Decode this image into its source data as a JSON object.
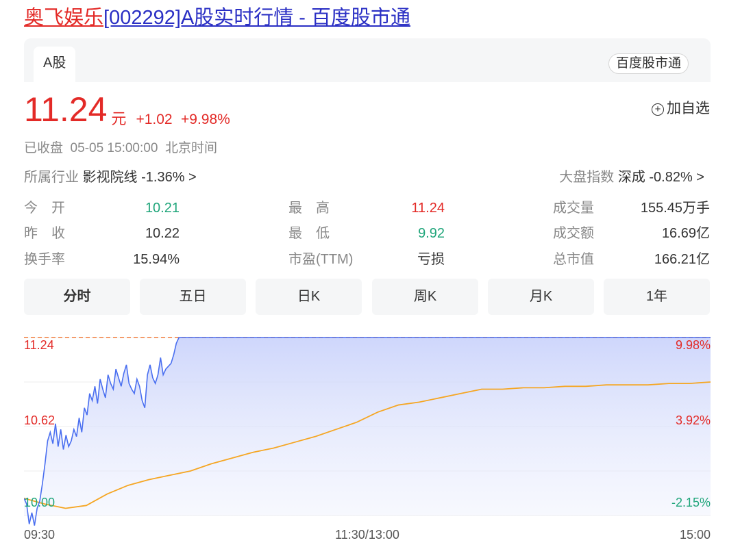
{
  "page": {
    "title_name": "奥飞娱乐",
    "title_rest": "[002292]A股实时行情 - 百度股市通"
  },
  "card": {
    "tab_label": "A股",
    "source_button": "百度股市通"
  },
  "quote": {
    "price": "11.24",
    "unit": "元",
    "change": "+1.02",
    "change_pct": "+9.98%",
    "add_watch": "加自选",
    "status": "已收盘  05-05 15:00:00  北京时间",
    "industry_label": "所属行业",
    "industry_value": "影视院线 -1.36% >",
    "index_label": "大盘指数",
    "index_value": "深成 -0.82% >"
  },
  "metrics": {
    "open_label": "今　开",
    "open_value": "10.21",
    "prev_close_label": "昨　收",
    "prev_close_value": "10.22",
    "turnover_rate_label": "换手率",
    "turnover_rate_value": "15.94%",
    "high_label": "最　高",
    "high_value": "11.24",
    "low_label": "最　低",
    "low_value": "9.92",
    "pe_label": "市盈(TTM)",
    "pe_value": "亏损",
    "volume_label": "成交量",
    "volume_value": "155.45万手",
    "amount_label": "成交额",
    "amount_value": "16.69亿",
    "market_cap_label": "总市值",
    "market_cap_value": "166.21亿"
  },
  "period_tabs": [
    "分时",
    "五日",
    "日K",
    "周K",
    "月K",
    "1年"
  ],
  "colors": {
    "up": "#e32a27",
    "down": "#1fa57a",
    "price_line": "#4a6ff0",
    "avg_line": "#f5a623",
    "limit_line": "#f07a3a"
  },
  "chart_data": {
    "type": "line",
    "y_left_ticks": [
      "11.24",
      "10.62",
      "10.00"
    ],
    "y_right_ticks": [
      "9.98%",
      "3.92%",
      "-2.15%"
    ],
    "x_ticks": [
      "09:30",
      "11:30/13:00",
      "15:00"
    ],
    "ylim": [
      10.0,
      11.24
    ],
    "series": [
      {
        "values": [
          10.12,
          10.08,
          9.94,
          10.02,
          9.93,
          10.05,
          10.1,
          10.22,
          10.36,
          10.52,
          10.58,
          10.5,
          10.64,
          10.48,
          10.6,
          10.46,
          10.56,
          10.48,
          10.52,
          10.6,
          10.55,
          10.68,
          10.58,
          10.75,
          10.7,
          10.85,
          10.8,
          10.9,
          10.78,
          10.95,
          10.88,
          10.82,
          10.98,
          10.92,
          10.88,
          11.02,
          10.96,
          10.9,
          10.99,
          11.05,
          10.92,
          10.88,
          10.85,
          10.95,
          10.9,
          10.8,
          10.75,
          10.98,
          11.05,
          10.96,
          10.92,
          10.98,
          11.1,
          10.98,
          11.02,
          11.04,
          11.06,
          11.12,
          11.2,
          11.24,
          11.24
        ]
      },
      {
        "values": [
          10.12,
          10.08,
          10.05,
          10.07,
          10.15,
          10.21,
          10.25,
          10.28,
          10.31,
          10.36,
          10.4,
          10.44,
          10.47,
          10.51,
          10.55,
          10.6,
          10.65,
          10.72,
          10.77,
          10.79,
          10.82,
          10.85,
          10.88,
          10.88,
          10.89,
          10.89,
          10.9,
          10.9,
          10.91,
          10.91,
          10.91,
          10.92,
          10.92,
          10.93
        ]
      }
    ]
  }
}
